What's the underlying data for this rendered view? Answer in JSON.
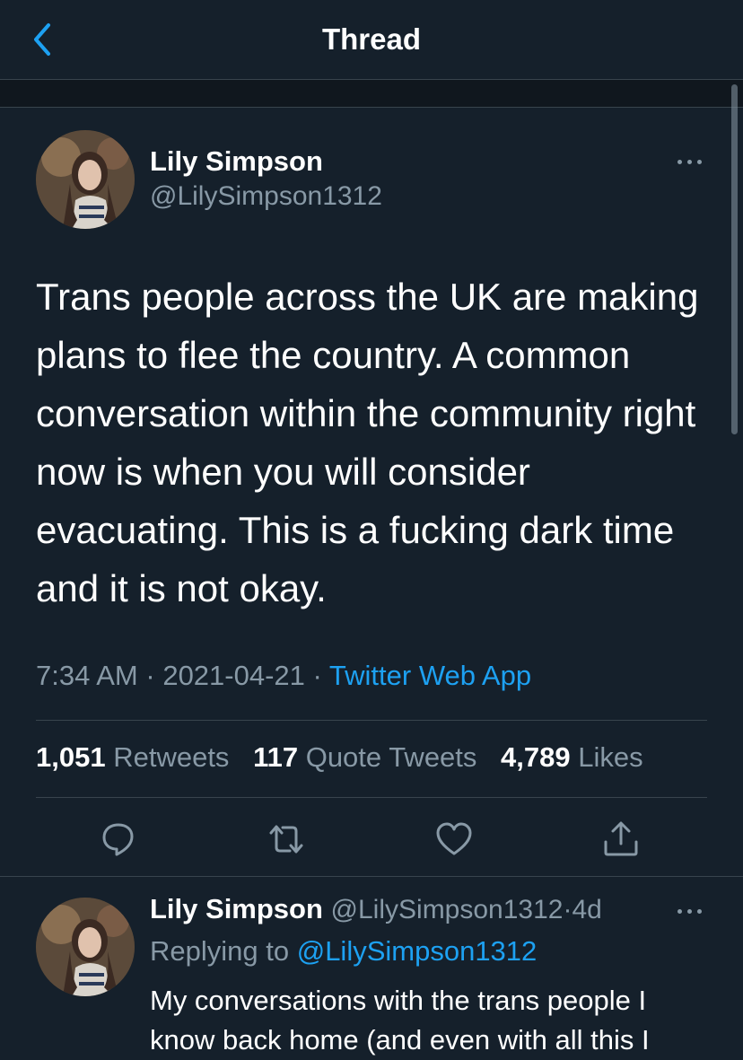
{
  "header": {
    "title": "Thread",
    "back_icon": "chevron-left-icon"
  },
  "colors": {
    "background": "#15202b",
    "accent": "#1da1f2",
    "muted": "#8899a6",
    "divider": "#38444d"
  },
  "tweet": {
    "author_name": "Lily Simpson",
    "author_handle": "@LilySimpson1312",
    "text": "Trans people across the UK are making plans to flee the country. A common conversation within the community right now is when you will consider evacuating. This is a fucking dark time and it is not okay.",
    "time": "7:34 AM",
    "sep1": "·",
    "date": "2021-04-21",
    "sep2": "·",
    "source": "Twitter Web App",
    "stats": {
      "retweets_count": "1,051",
      "retweets_label": "Retweets",
      "quotes_count": "117",
      "quotes_label": "Quote Tweets",
      "likes_count": "4,789",
      "likes_label": "Likes"
    }
  },
  "reply": {
    "author_name": "Lily Simpson",
    "author_handle": "@LilySimpson1312",
    "age_sep": "·",
    "age": "4d",
    "replying_label": "Replying to",
    "replying_handle": "@LilySimpson1312",
    "text": "My conversations with the trans people I know back home (and even with all this I"
  }
}
